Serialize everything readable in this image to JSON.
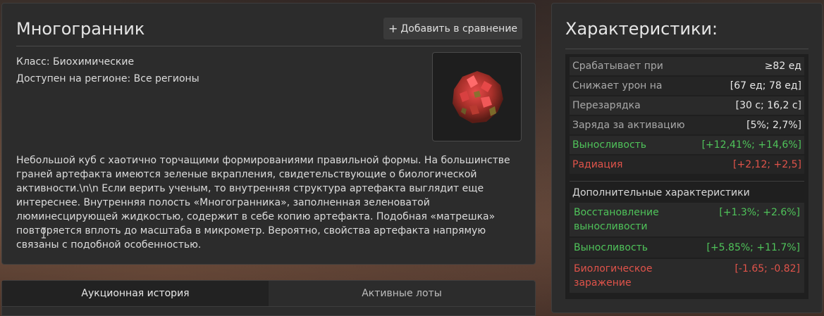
{
  "main": {
    "title": "Многогранник",
    "compare_button": "Добавить в сравнение",
    "class_line": "Класс: Биохимические",
    "region_line": "Доступен на регионе: Все регионы",
    "description": "Небольшой куб с хаотично торчащими формированиями правильной формы. На большинстве граней артефакта имеются зеленые вкрапления, свидетельствующие о биологической активности.\\n\\n Если верить ученым, то внутренняя структура артефакта выглядит еще интереснее. Внутренняя полость «Многогранника», заполненная зеленоватой люминесцирующей жидкостью, содержит в себе копию артефакта. Подобная «матрешка» повторяется вплоть до масштаба в микрометр. Вероятно, свойства артефакта напрямую связаны с подобной особенностью."
  },
  "tabs": [
    {
      "label": "Аукционная история",
      "active": true
    },
    {
      "label": "Активные лоты",
      "active": false
    }
  ],
  "stats": {
    "title": "Характеристики:",
    "rows": [
      {
        "label": "Срабатывает при",
        "value": "≥82 ед",
        "color": "neutral"
      },
      {
        "label": "Снижает урон на",
        "value": "[67 ед; 78 ед]",
        "color": "neutral"
      },
      {
        "label": "Перезарядка",
        "value": "[30 с; 16,2 с]",
        "color": "neutral"
      },
      {
        "label": "Заряда за активацию",
        "value": "[5%; 2,7%]",
        "color": "neutral"
      },
      {
        "label": "Выносливость",
        "value": "[+12,41%; +14,6%]",
        "color": "green"
      },
      {
        "label": "Радиация",
        "value": "[+2,12; +2,5]",
        "color": "red"
      }
    ],
    "extra_title": "Дополнительные характеристики",
    "extra_rows": [
      {
        "label": "Восстановление выносливости",
        "value": "[+1.3%; +2.6%]",
        "color": "green"
      },
      {
        "label": "Выносливость",
        "value": "[+5.85%; +11.7%]",
        "color": "green"
      },
      {
        "label": "Биологическое заражение",
        "value": "[-1.65; -0.82]",
        "color": "red"
      }
    ]
  },
  "colors": {
    "green": "#4fc35a",
    "red": "#e0534a",
    "panel": "#2c2c2c"
  }
}
